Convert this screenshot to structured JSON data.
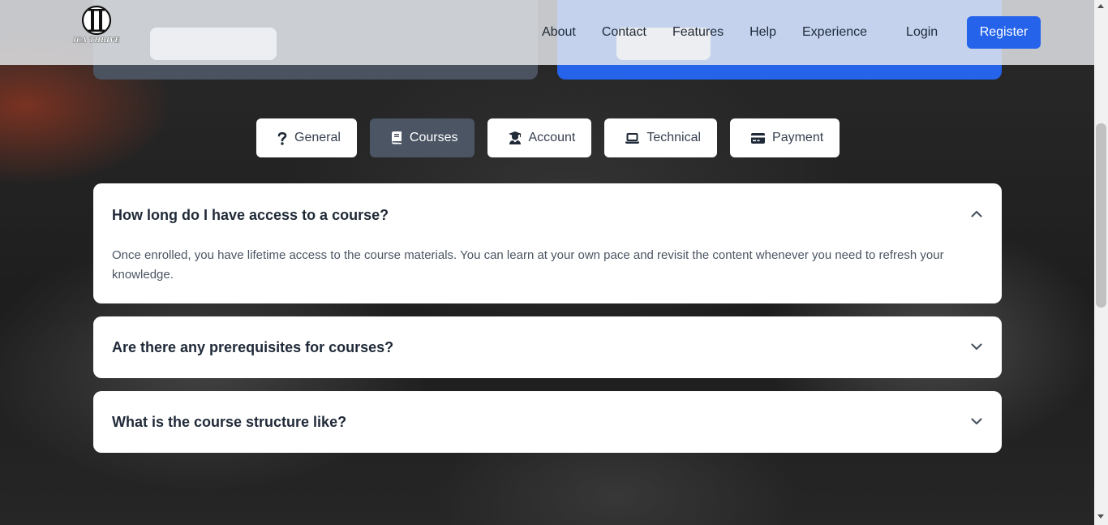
{
  "brand": {
    "logo_text": "ICA THRIVE"
  },
  "nav": {
    "links": [
      "About",
      "Contact",
      "Features",
      "Help",
      "Experience"
    ],
    "login": "Login",
    "register": "Register"
  },
  "tabs": [
    {
      "label": "General",
      "icon": "question-icon",
      "active": false
    },
    {
      "label": "Courses",
      "icon": "book-icon",
      "active": true
    },
    {
      "label": "Account",
      "icon": "user-graduate-icon",
      "active": false
    },
    {
      "label": "Technical",
      "icon": "laptop-icon",
      "active": false
    },
    {
      "label": "Payment",
      "icon": "credit-card-icon",
      "active": false
    }
  ],
  "faq": [
    {
      "question": "How long do I have access to a course?",
      "answer": "Once enrolled, you have lifetime access to the course materials. You can learn at your own pace and revisit the content whenever you need to refresh your knowledge.",
      "expanded": true
    },
    {
      "question": "Are there any prerequisites for courses?",
      "answer": "",
      "expanded": false
    },
    {
      "question": "What is the course structure like?",
      "answer": "",
      "expanded": false
    }
  ],
  "colors": {
    "accent": "#2563eb",
    "active_tab": "#4b5563",
    "text_dark": "#1f2937",
    "text_muted": "#4b5563"
  }
}
